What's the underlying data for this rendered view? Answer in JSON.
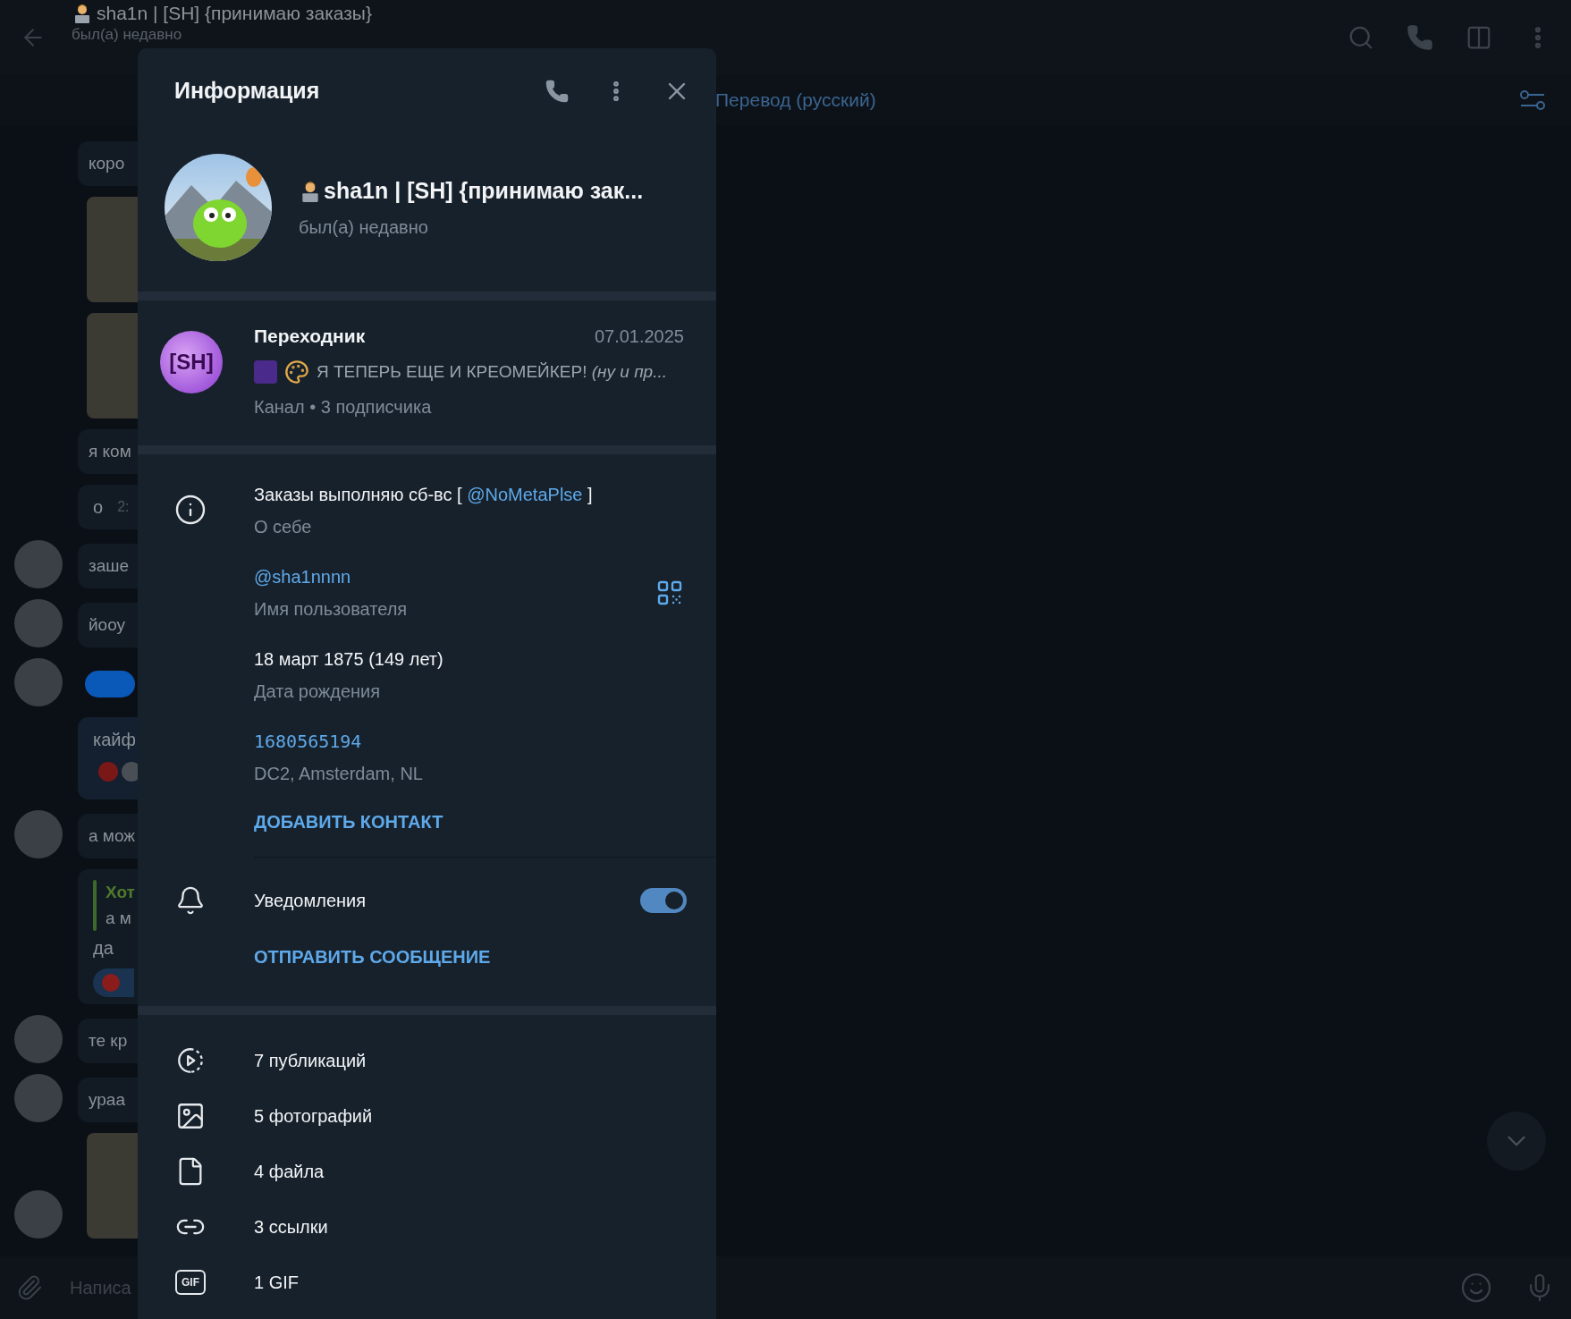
{
  "chat_header": {
    "title": "sha1n | [SH] {принимаю заказы}",
    "status": "был(а) недавно"
  },
  "translate_bar": {
    "label": "Перевод (русский)"
  },
  "messages": [
    {
      "kind": "text",
      "text": "коро",
      "avatar": false
    },
    {
      "kind": "image",
      "avatar": false
    },
    {
      "kind": "image",
      "avatar": false
    },
    {
      "kind": "text",
      "text": "я ком",
      "avatar": false
    },
    {
      "kind": "timed",
      "text": "о",
      "time": "2:",
      "avatar": false
    },
    {
      "kind": "text",
      "text": "заше",
      "avatar": true
    },
    {
      "kind": "text",
      "text": "йооу",
      "avatar": true
    },
    {
      "kind": "sticker",
      "avatar": true
    },
    {
      "kind": "reactions",
      "text": "кайф",
      "avatar": false
    },
    {
      "kind": "text",
      "text": "а мож",
      "avatar": true
    },
    {
      "kind": "reply",
      "reply_author": "Хот",
      "reply_text": "а м",
      "text": "да",
      "avatar": false
    },
    {
      "kind": "text",
      "text": "те кр",
      "avatar": true
    },
    {
      "kind": "text",
      "text": "ураа",
      "avatar": true
    },
    {
      "kind": "image",
      "avatar": true
    }
  ],
  "composer": {
    "placeholder": "Написа"
  },
  "info_panel": {
    "title": "Информация",
    "profile": {
      "name": "sha1n | [SH] {принимаю зак...",
      "status": "был(а) недавно"
    },
    "channel": {
      "logo_text": "[SH]",
      "name": "Переходник",
      "date": "07.01.2025",
      "preview": "Я ТЕПЕРЬ ЕЩЕ И КРЕОМЕЙКЕР! *(ну и пр...*",
      "meta": "Канал • 3 подписчика"
    },
    "about": {
      "text_before": "Заказы выполняю сб-вс [",
      "link": "@NoMetaPlse",
      "text_after": "]",
      "label": "О себе"
    },
    "username": {
      "value": "@sha1nnnn",
      "label": "Имя пользователя"
    },
    "birthday": {
      "value": "18 март 1875 (149 лет)",
      "label": "Дата рождения"
    },
    "id": {
      "value": "1680565194",
      "label": "DC2, Amsterdam, NL"
    },
    "add_contact": "ДОБАВИТЬ КОНТАКТ",
    "notifications": {
      "label": "Уведомления",
      "on": true
    },
    "send_message": "ОТПРАВИТЬ СООБЩЕНИЕ",
    "media": [
      {
        "kind": "posts",
        "label": "7 публикаций"
      },
      {
        "kind": "photos",
        "label": "5 фотографий"
      },
      {
        "kind": "files",
        "label": "4 файла"
      },
      {
        "kind": "links",
        "label": "3 ссылки"
      },
      {
        "kind": "gifs",
        "label": "1 GIF",
        "icon_text": "GIF"
      }
    ]
  }
}
